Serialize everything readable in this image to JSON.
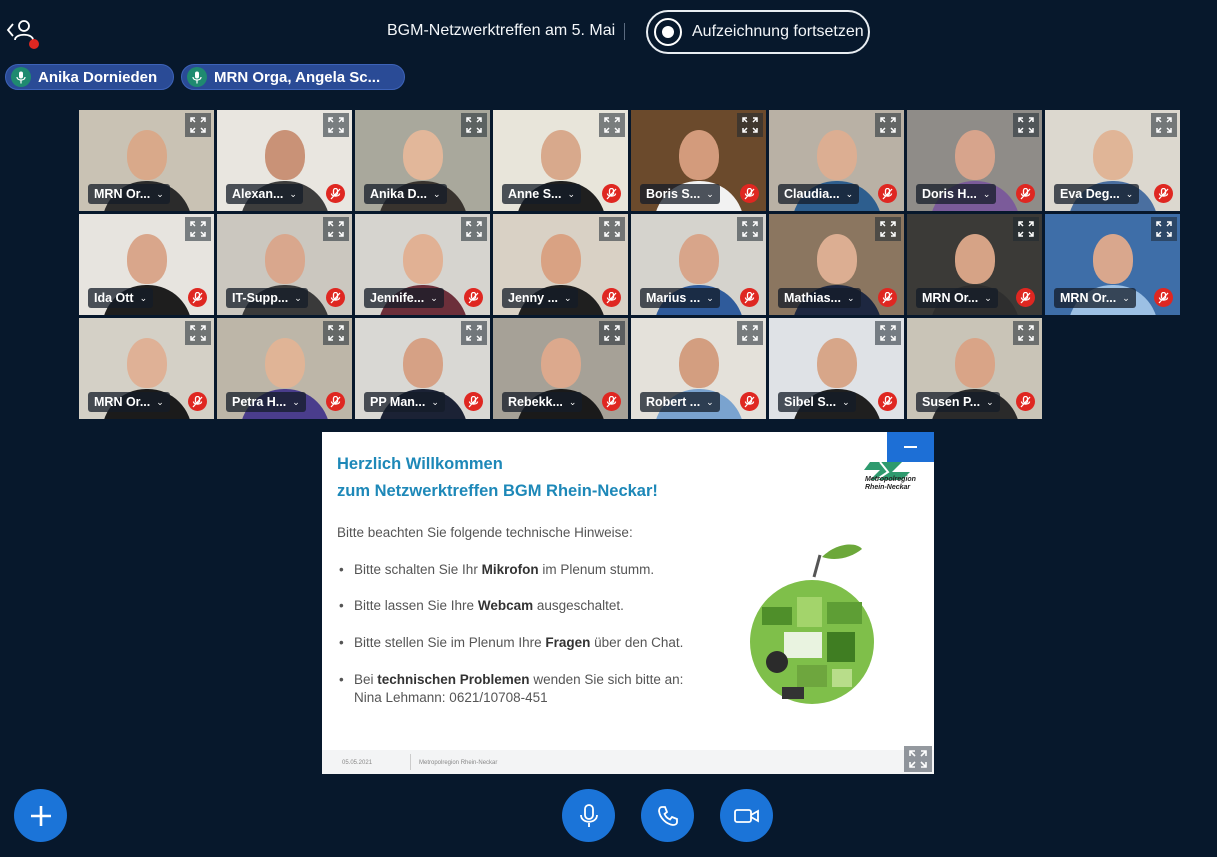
{
  "header": {
    "meeting_title": "BGM-Netzwerktreffen am 5. Mai",
    "record_label": "Aufzeichnung fortsetzen"
  },
  "talkers": [
    {
      "name": "Anika Dornieden"
    },
    {
      "name": "MRN Orga, Angela Sc..."
    }
  ],
  "participants": [
    {
      "name": "MRN Or...",
      "muted": false,
      "active": true,
      "bg": "#c9c2b4",
      "skin": "#d9a98a",
      "shirt": "#2b2b2b"
    },
    {
      "name": "Alexan...",
      "muted": true,
      "active": false,
      "bg": "#e9e6e0",
      "skin": "#c99277",
      "shirt": "#3d3d3d"
    },
    {
      "name": "Anika D...",
      "muted": false,
      "active": true,
      "bg": "#a9a89c",
      "skin": "#e2b79a",
      "shirt": "#38332e"
    },
    {
      "name": "Anne S...",
      "muted": true,
      "active": false,
      "bg": "#e8e5da",
      "skin": "#d8a98c",
      "shirt": "#1f1f1f"
    },
    {
      "name": "Boris S...",
      "muted": true,
      "active": false,
      "bg": "#6b4a2c",
      "skin": "#d39b7c",
      "shirt": "#f2f2f2"
    },
    {
      "name": "Claudia...",
      "muted": true,
      "active": false,
      "bg": "#b9b1a5",
      "skin": "#dcae92",
      "shirt": "#2d5e8e"
    },
    {
      "name": "Doris H...",
      "muted": true,
      "active": false,
      "bg": "#8f8c88",
      "skin": "#d7a48c",
      "shirt": "#7b5b9a"
    },
    {
      "name": "Eva Deg...",
      "muted": true,
      "active": false,
      "bg": "#dcd8cf",
      "skin": "#e0b597",
      "shirt": "#4a6fa0"
    },
    {
      "name": "Ida Ott",
      "muted": true,
      "active": false,
      "bg": "#e7e4df",
      "skin": "#d9a68b",
      "shirt": "#1e1e1e"
    },
    {
      "name": "IT-Supp...",
      "muted": true,
      "active": false,
      "bg": "#cbc7bf",
      "skin": "#d9a78d",
      "shirt": "#3a3a3a"
    },
    {
      "name": "Jennife...",
      "muted": true,
      "active": false,
      "bg": "#d6d4cf",
      "skin": "#e1b194",
      "shirt": "#6c2f3a"
    },
    {
      "name": "Jenny ...",
      "muted": true,
      "active": false,
      "bg": "#d9d1c5",
      "skin": "#d9a283",
      "shirt": "#1f1f1f"
    },
    {
      "name": "Marius ...",
      "muted": true,
      "active": false,
      "bg": "#d5d3cd",
      "skin": "#d8a58a",
      "shirt": "#2f5b9b"
    },
    {
      "name": "Mathias...",
      "muted": true,
      "active": false,
      "bg": "#8b7660",
      "skin": "#dcae92",
      "shirt": "#1d2740"
    },
    {
      "name": "MRN Or...",
      "muted": true,
      "active": false,
      "bg": "#3b3a37",
      "skin": "#d6a386",
      "shirt": "#2e2e2e"
    },
    {
      "name": "MRN Or...",
      "muted": true,
      "active": false,
      "bg": "#3e6ea8",
      "skin": "#d9a78d",
      "shirt": "#9cc0e4"
    },
    {
      "name": "MRN Or...",
      "muted": true,
      "active": false,
      "bg": "#d4d0c6",
      "skin": "#dfb196",
      "shirt": "#1b1b1b"
    },
    {
      "name": "Petra H...",
      "muted": true,
      "active": false,
      "bg": "#bdb6a8",
      "skin": "#e0b496",
      "shirt": "#4a3d8c"
    },
    {
      "name": "PP Man...",
      "muted": true,
      "active": false,
      "bg": "#d9d8d4",
      "skin": "#d6a185",
      "shirt": "#1b2235"
    },
    {
      "name": "Rebekk...",
      "muted": true,
      "active": false,
      "bg": "#a6a197",
      "skin": "#dca98d",
      "shirt": "#1a1a1a"
    },
    {
      "name": "Robert ...",
      "muted": true,
      "active": false,
      "bg": "#e4e1da",
      "skin": "#d39e80",
      "shirt": "#7aa3cf"
    },
    {
      "name": "Sibel S...",
      "muted": true,
      "active": false,
      "bg": "#dfe2e6",
      "skin": "#d7a689",
      "shirt": "#1f1f1f"
    },
    {
      "name": "Susen P...",
      "muted": true,
      "active": false,
      "bg": "#c9c4b7",
      "skin": "#d9a487",
      "shirt": "#2a2a2a"
    }
  ],
  "slide": {
    "title_line1": "Herzlich Willkommen",
    "title_line2": "zum Netzwerktreffen BGM Rhein-Neckar!",
    "intro": "Bitte beachten Sie folgende technische Hinweise:",
    "bullets": [
      {
        "pre": "Bitte schalten Sie Ihr ",
        "bold": "Mikrofon",
        "post": " im Plenum stumm.",
        "line2": ""
      },
      {
        "pre": "Bitte lassen Sie Ihre ",
        "bold": "Webcam",
        "post": " ausgeschaltet.",
        "line2": ""
      },
      {
        "pre": "Bitte stellen Sie im Plenum Ihre ",
        "bold": "Fragen",
        "post": " über den Chat.",
        "line2": ""
      },
      {
        "pre": "Bei ",
        "bold": "technischen Problemen",
        "post": " wenden Sie sich bitte an:",
        "line2": "Nina Lehmann: 0621/10708-451"
      }
    ],
    "logo_line1": "Metropolregion",
    "logo_line2": "Rhein-Neckar",
    "footer_date": "05.05.2021",
    "footer_org": "Metropolregion Rhein-Neckar"
  },
  "colors": {
    "background": "#07182c",
    "accent": "#1b74d8",
    "muted_badge": "#df2721",
    "slide_title": "#1d88b8"
  },
  "icons": {
    "users": "users-icon",
    "record": "record-icon",
    "expand": "expand-icon",
    "muted": "mic-off-icon",
    "plus": "plus-icon",
    "mic": "microphone-icon",
    "phone": "phone-icon",
    "camera": "video-camera-icon"
  }
}
